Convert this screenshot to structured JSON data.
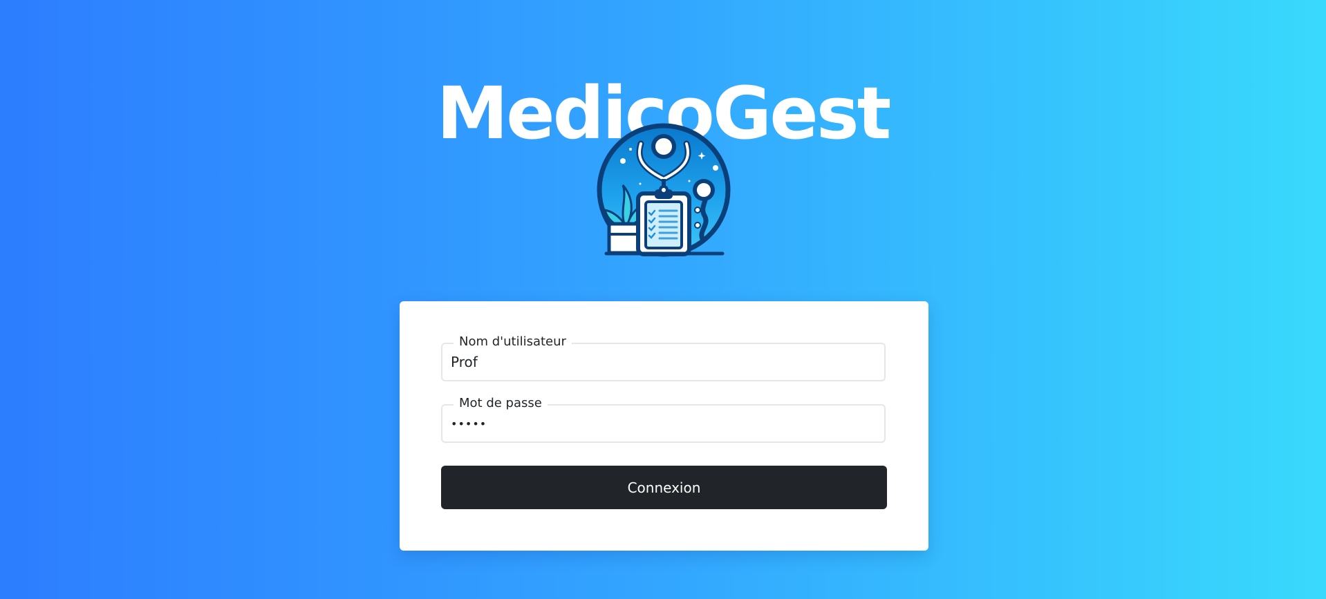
{
  "app": {
    "title": "MedicoGest",
    "logo_icon": "medical-clipboard-stethoscope-icon"
  },
  "login_form": {
    "username": {
      "label": "Nom d'utilisateur",
      "value": "Prof"
    },
    "password": {
      "label": "Mot de passe",
      "value": "•••••"
    },
    "submit_label": "Connexion"
  },
  "colors": {
    "background_start": "#2d7dff",
    "background_end": "#39d9fc",
    "card": "#ffffff",
    "button": "#212529",
    "button_text": "#ffffff"
  }
}
